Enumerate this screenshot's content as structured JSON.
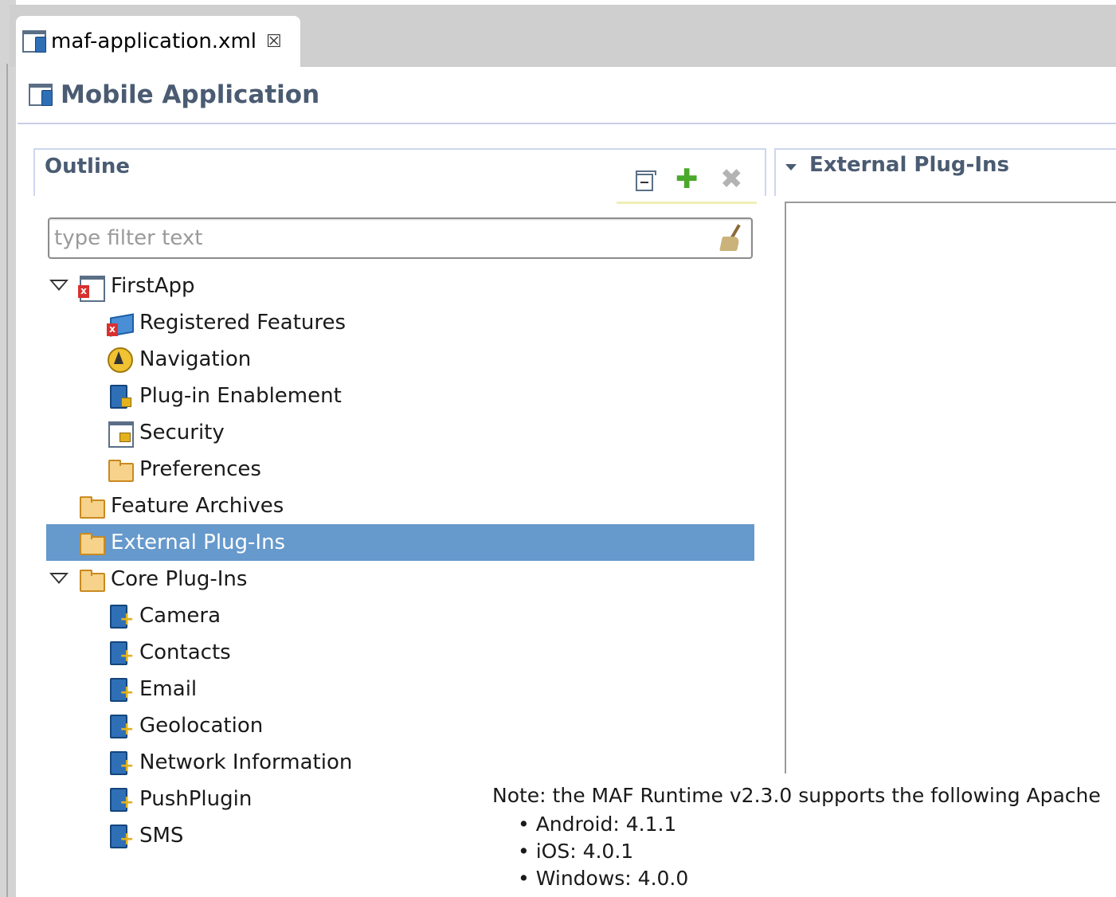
{
  "editor_tab": {
    "title": "maf-application.xml",
    "close_glyph": "☒"
  },
  "header": {
    "title": "Mobile Application"
  },
  "outline": {
    "title": "Outline",
    "toolbar": {
      "collapse_icon": "collapse-all-icon",
      "add_icon": "add-icon",
      "remove_icon": "remove-icon",
      "add_glyph": "✚",
      "remove_glyph": "✖"
    },
    "filter": {
      "placeholder": "type filter text",
      "value": ""
    },
    "tree": {
      "firstapp": "FirstApp",
      "registered_features": "Registered Features",
      "navigation": "Navigation",
      "plugin_enablement": "Plug-in Enablement",
      "security": "Security",
      "preferences": "Preferences",
      "feature_archives": "Feature Archives",
      "external_plugins": "External Plug-Ins",
      "core_plugins": "Core Plug-Ins",
      "core_children": [
        "Camera",
        "Contacts",
        "Email",
        "Geolocation",
        "Network Information",
        "PushPlugin",
        "SMS"
      ]
    }
  },
  "details": {
    "title": "External Plug-Ins"
  },
  "note": {
    "text": "Note: the MAF Runtime v2.3.0 supports the following Apache",
    "items": [
      "Android: 4.1.1",
      "iOS: 4.0.1",
      "Windows: 4.0.0"
    ]
  },
  "colors": {
    "selection": "#6699cc",
    "section_title": "#4a5b72",
    "add_green": "#4aa82a"
  }
}
